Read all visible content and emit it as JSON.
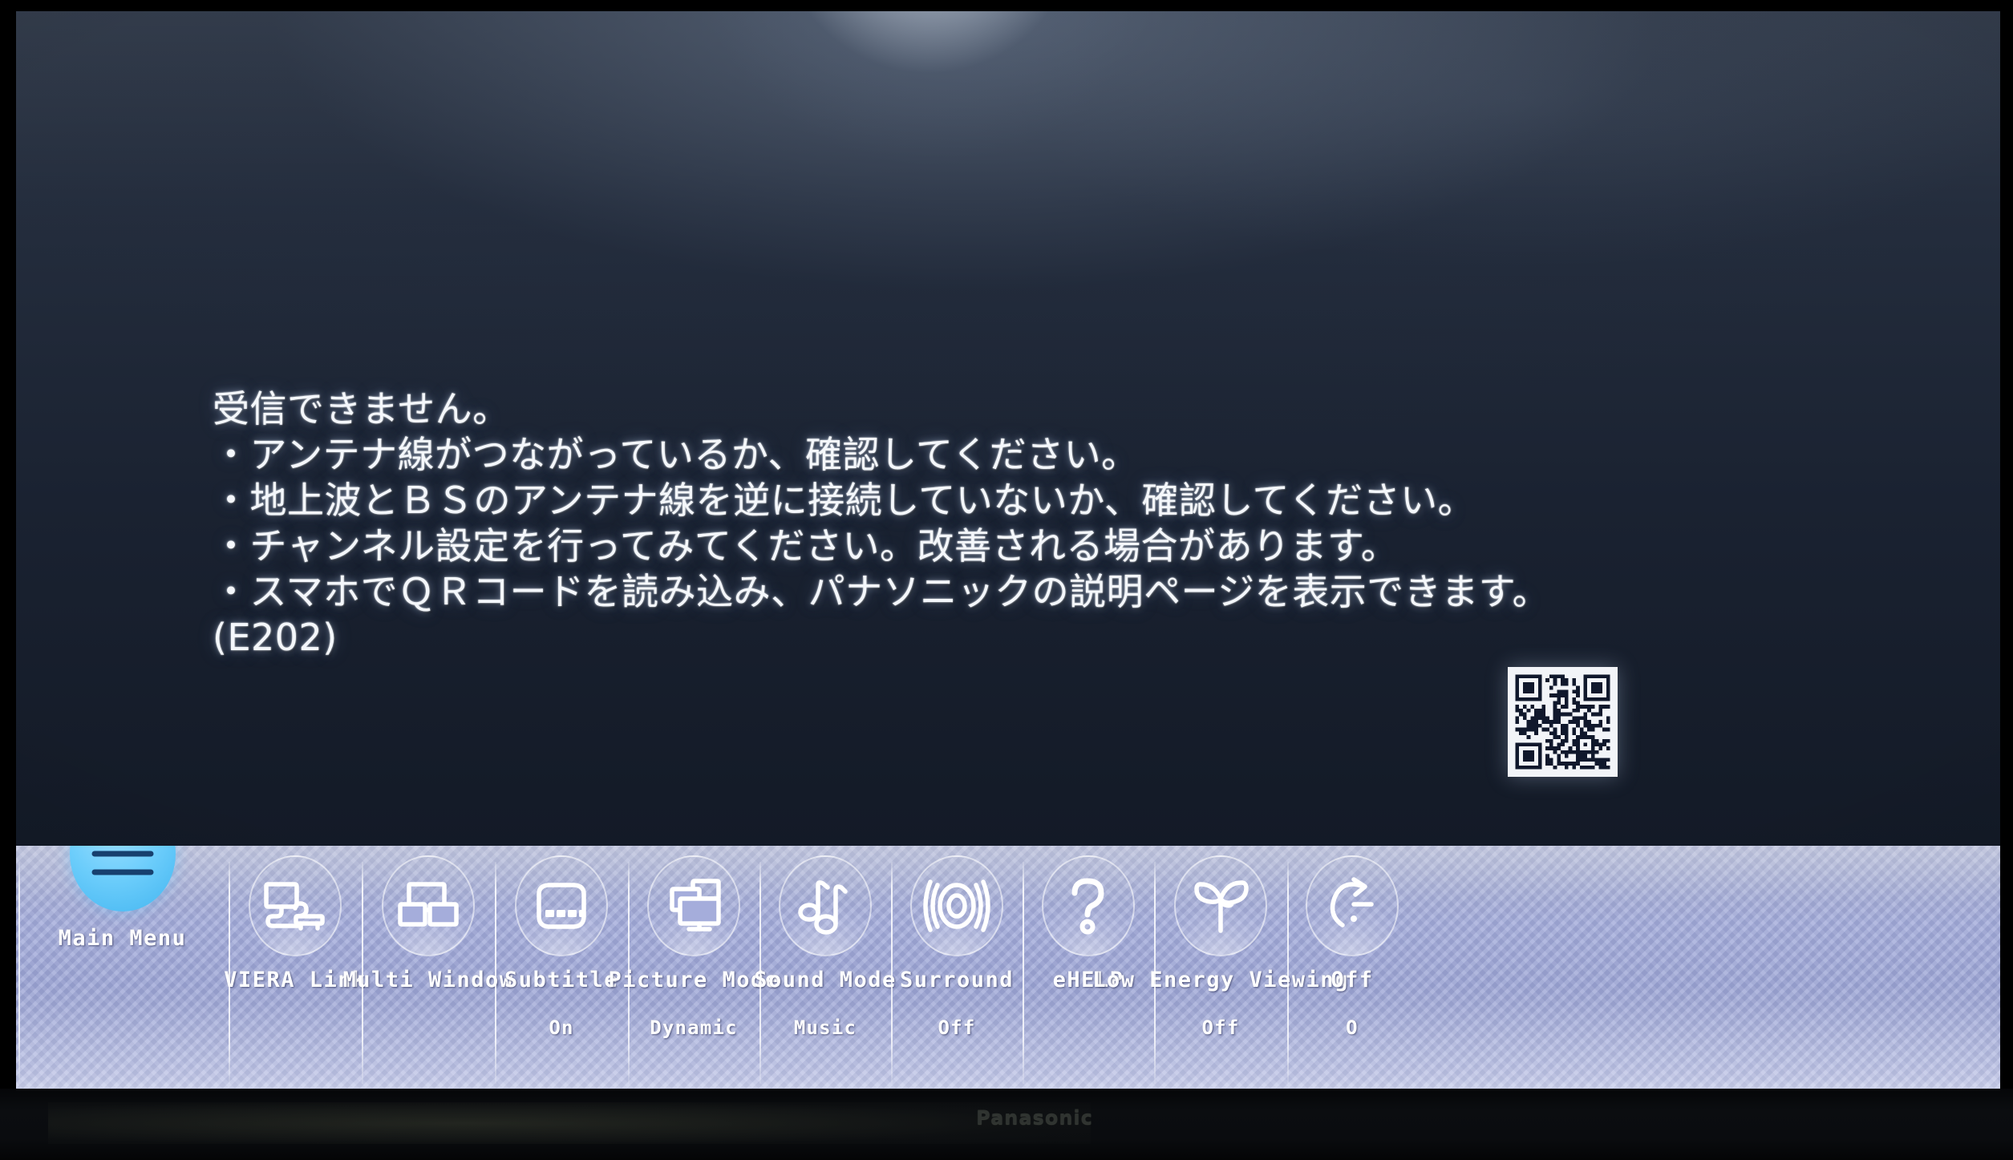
{
  "device": {
    "brand": "Panasonic",
    "brand_visible": true
  },
  "screen": {
    "message_lines": [
      "受信できません。",
      "・アンテナ線がつながっているか、確認してください。",
      "・地上波とＢＳのアンテナ線を逆に接続していないか、確認してください。",
      "・チャンネル設定を行ってみてください。改善される場合があります。",
      "・スマホでＱＲコードを読み込み、パナソニックの説明ページを表示できます。",
      "(E202)"
    ],
    "error_code": "E202",
    "qr_code": {
      "name": "qr-code",
      "description": "QR code linking to Panasonic support page"
    }
  },
  "option_bar": {
    "selected_index": 0,
    "accent_color": "#6ccdfb",
    "bar_color": "#a5addb",
    "items": [
      {
        "label": "Main Menu",
        "value": "",
        "icon": "hamburger-menu-icon",
        "selected": true
      },
      {
        "label": "VIERA Link",
        "value": "",
        "icon": "viera-link-icon",
        "selected": false
      },
      {
        "label": "Multi Window",
        "value": "",
        "icon": "multi-window-icon",
        "selected": false
      },
      {
        "label": "Subtitle",
        "value": "On",
        "icon": "subtitle-icon",
        "selected": false
      },
      {
        "label": "Picture Mode",
        "value": "Dynamic",
        "icon": "picture-mode-icon",
        "selected": false
      },
      {
        "label": "Sound Mode",
        "value": "Music",
        "icon": "sound-mode-icon",
        "selected": false
      },
      {
        "label": "Surround",
        "value": "Off",
        "icon": "surround-icon",
        "selected": false
      },
      {
        "label": "eHELP",
        "value": "",
        "icon": "question-mark-icon",
        "selected": false
      },
      {
        "label": "Low Energy Viewing",
        "value": "Off",
        "icon": "leaf-sprout-icon",
        "selected": false
      },
      {
        "label": "Off",
        "value": "O",
        "icon": "off-timer-icon",
        "selected": false
      }
    ]
  }
}
